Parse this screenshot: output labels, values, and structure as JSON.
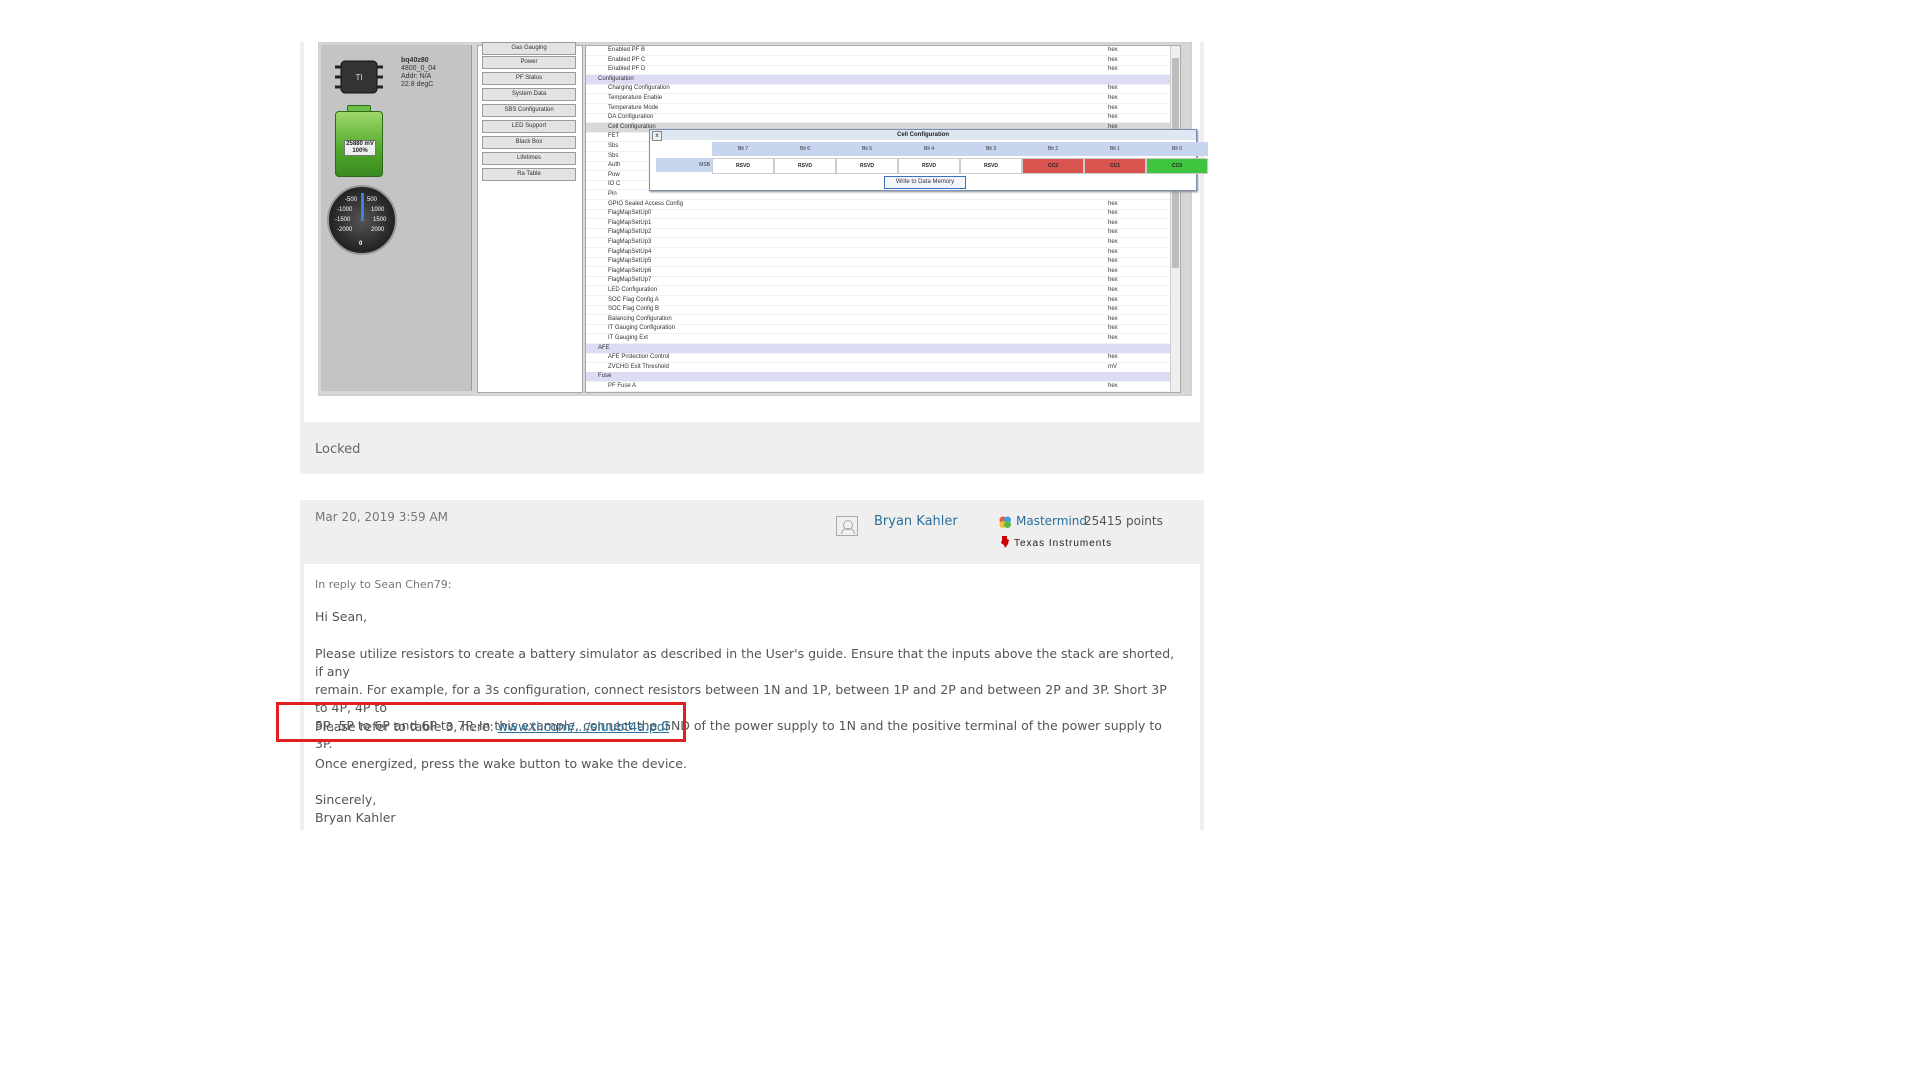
{
  "post1": {
    "screenshot": {
      "device": {
        "name": "bq40z80",
        "fw": "4800_0_04",
        "addr": "Addr: N/A",
        "temp": "22.8 degC"
      },
      "battery": {
        "voltage": "25880 mV",
        "percent": "100%"
      },
      "gauge": {
        "labels": [
          "-500",
          "500",
          "-1000",
          "1000",
          "-1500",
          "1500",
          "-2000",
          "2000",
          "0"
        ]
      },
      "menu": [
        "Gas Gauging",
        "Power",
        "PF Status",
        "System Data",
        "SBS Configuration",
        "LED Support",
        "Black Box",
        "Lifetimes",
        "Ra Table"
      ],
      "rows": [
        {
          "name": "Enabled PF B",
          "type": "hex",
          "kind": "row"
        },
        {
          "name": "Enabled PF C",
          "type": "hex",
          "kind": "row"
        },
        {
          "name": "Enabled PF D",
          "type": "hex",
          "kind": "row"
        },
        {
          "name": "Configuration",
          "type": "",
          "kind": "section"
        },
        {
          "name": "Charging Configuration",
          "type": "hex",
          "kind": "row"
        },
        {
          "name": "Temperature Enable",
          "type": "hex",
          "kind": "row"
        },
        {
          "name": "Temperature Mode",
          "type": "hex",
          "kind": "row"
        },
        {
          "name": "DA Configuration",
          "type": "hex",
          "kind": "row"
        },
        {
          "name": "Cell Configuration",
          "type": "hex",
          "kind": "sel"
        },
        {
          "name": "FET",
          "type": "",
          "kind": "row"
        },
        {
          "name": "Sbs",
          "type": "",
          "kind": "row"
        },
        {
          "name": "Sbs",
          "type": "",
          "kind": "row"
        },
        {
          "name": "Auth",
          "type": "",
          "kind": "row"
        },
        {
          "name": "Pow",
          "type": "",
          "kind": "row"
        },
        {
          "name": "IO C",
          "type": "",
          "kind": "row"
        },
        {
          "name": "Pin",
          "type": "",
          "kind": "row"
        },
        {
          "name": "GPIO Sealed Access Config",
          "type": "hex",
          "kind": "row"
        },
        {
          "name": "FlagMapSetUp0",
          "type": "hex",
          "kind": "row"
        },
        {
          "name": "FlagMapSetUp1",
          "type": "hex",
          "kind": "row"
        },
        {
          "name": "FlagMapSetUp2",
          "type": "hex",
          "kind": "row"
        },
        {
          "name": "FlagMapSetUp3",
          "type": "hex",
          "kind": "row"
        },
        {
          "name": "FlagMapSetUp4",
          "type": "hex",
          "kind": "row"
        },
        {
          "name": "FlagMapSetUp5",
          "type": "hex",
          "kind": "row"
        },
        {
          "name": "FlagMapSetUp6",
          "type": "hex",
          "kind": "row"
        },
        {
          "name": "FlagMapSetUp7",
          "type": "hex",
          "kind": "row"
        },
        {
          "name": "LED Configuration",
          "type": "hex",
          "kind": "row"
        },
        {
          "name": "SOC Flag Config A",
          "type": "hex",
          "kind": "row"
        },
        {
          "name": "SOC Flag Config B",
          "type": "hex",
          "kind": "row"
        },
        {
          "name": "Balancing Configuration",
          "type": "hex",
          "kind": "row"
        },
        {
          "name": "IT Gauging Configuration",
          "type": "hex",
          "kind": "row"
        },
        {
          "name": "IT Gauging Ext",
          "type": "hex",
          "kind": "row"
        },
        {
          "name": "AFE",
          "type": "",
          "kind": "section"
        },
        {
          "name": "AFE Protection Control",
          "type": "hex",
          "kind": "row"
        },
        {
          "name": "ZVCHG Exit Threshold",
          "type": "mV",
          "kind": "row"
        },
        {
          "name": "Fuse",
          "type": "",
          "kind": "section"
        },
        {
          "name": "PF Fuse A",
          "type": "hex",
          "kind": "row"
        }
      ],
      "popup": {
        "title": "Cell Configuration",
        "close": "x",
        "row_label": "MSB",
        "bits": [
          {
            "head": "Bit 7",
            "val": "RSVD",
            "color": "#ffffff"
          },
          {
            "head": "Bit 6",
            "val": "RSVD",
            "color": "#ffffff"
          },
          {
            "head": "Bit 5",
            "val": "RSVD",
            "color": "#ffffff"
          },
          {
            "head": "Bit 4",
            "val": "RSVD",
            "color": "#ffffff"
          },
          {
            "head": "Bit 3",
            "val": "RSVD",
            "color": "#ffffff"
          },
          {
            "head": "Bit 2",
            "val": "CC2",
            "color": "#d9534f"
          },
          {
            "head": "Bit 1",
            "val": "CC1",
            "color": "#d9534f"
          },
          {
            "head": "Bit 0",
            "val": "CC0",
            "color": "#3ec43e"
          }
        ],
        "write_button": "Write to Data Memory"
      }
    },
    "status": "Locked"
  },
  "post2": {
    "date": "Mar 20, 2019 3:59 AM",
    "author": "Bryan Kahler",
    "rank": "Mastermind",
    "points": "25415 points",
    "company": "Texas Instruments",
    "reply_to": "In reply to Sean Chen79:",
    "greeting": "Hi Sean,",
    "para1_line1": "Please utilize resistors to create a battery simulator as described in the User's guide. Ensure that the inputs above the stack are shorted, if any",
    "para1_line2": "remain. For example, for a 3s configuration, connect resistors between 1N and 1P, between 1P and 2P and between 2P and 3P. Short 3P to 4P, 4P to",
    "para1_line3": "5P, 5P to 6P and 6P to 7P. In this example, connect the GND of the power supply to 1N and the positive terminal of the power supply to 3P.",
    "para2_prefix": "Please refer to table 3, here: ",
    "para2_link": "www.ti.com/.../sluubt4a.pdf",
    "para3": "Once energized, press the wake button to wake the device.",
    "closing": "Sincerely,",
    "signature": "Bryan Kahler"
  },
  "colors": {
    "link": "#2d6f9a",
    "highlight": "#e0201e",
    "post_bg": "#efefef"
  }
}
